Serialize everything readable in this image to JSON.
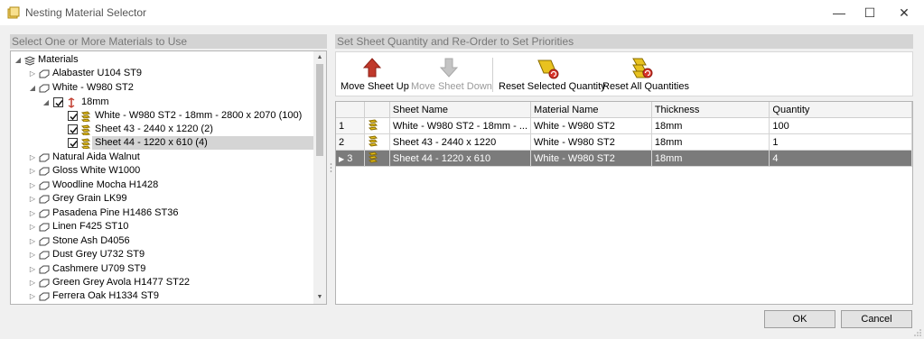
{
  "window": {
    "title": "Nesting Material Selector",
    "minimize_icon": "minimize-icon",
    "maximize_icon": "maximize-icon",
    "close_icon": "close-icon"
  },
  "left_panel": {
    "header": "Select One or More Materials to Use",
    "tree": {
      "root_label": "Materials",
      "white_group_label": "White - W980 ST2",
      "thickness_label": "18mm",
      "sheets": [
        {
          "label": "White - W980 ST2 - 18mm - 2800 x 2070 (100)",
          "checked": true
        },
        {
          "label": "Sheet 43 - 2440 x 1220 (2)",
          "checked": true
        },
        {
          "label": "Sheet 44 - 1220 x 610 (4)",
          "checked": true,
          "selected": true
        }
      ],
      "materials": [
        "Alabaster U104 ST9",
        "Natural Aida Walnut",
        "Gloss White W1000",
        "Woodline Mocha H1428",
        "Grey Grain LK99",
        "Pasadena Pine H1486 ST36",
        "Linen F425 ST10",
        "Stone Ash D4056",
        "Dust Grey U732 ST9",
        "Cashmere U709 ST9",
        "Green Grey Avola H1477 ST22",
        "Ferrera Oak H1334 ST9"
      ]
    }
  },
  "right_panel": {
    "header": "Set Sheet Quantity and Re-Order to Set Priorities",
    "toolbar": {
      "move_up": "Move Sheet Up",
      "move_down": "Move Sheet Down",
      "reset_selected": "Reset Selected Quantity",
      "reset_all": "Reset All Quantities"
    },
    "grid": {
      "columns": [
        "Sheet Name",
        "Material Name",
        "Thickness",
        "Quantity"
      ],
      "rows": [
        {
          "num": "1",
          "sheet_name": "White - W980 ST2 - 18mm - ...",
          "material": "White - W980 ST2",
          "thickness": "18mm",
          "quantity": "100"
        },
        {
          "num": "2",
          "sheet_name": "Sheet 43 - 2440 x 1220",
          "material": "White - W980 ST2",
          "thickness": "18mm",
          "quantity": "1"
        },
        {
          "num": "3",
          "sheet_name": "Sheet 44 - 1220 x 610",
          "material": "White - W980 ST2",
          "thickness": "18mm",
          "quantity": "4",
          "selected": true
        }
      ]
    }
  },
  "buttons": {
    "ok": "OK",
    "cancel": "Cancel"
  },
  "colors": {
    "accent_red": "#c0392b",
    "sheet_yellow": "#e8c21f",
    "selected_row": "#7b7b7b"
  }
}
